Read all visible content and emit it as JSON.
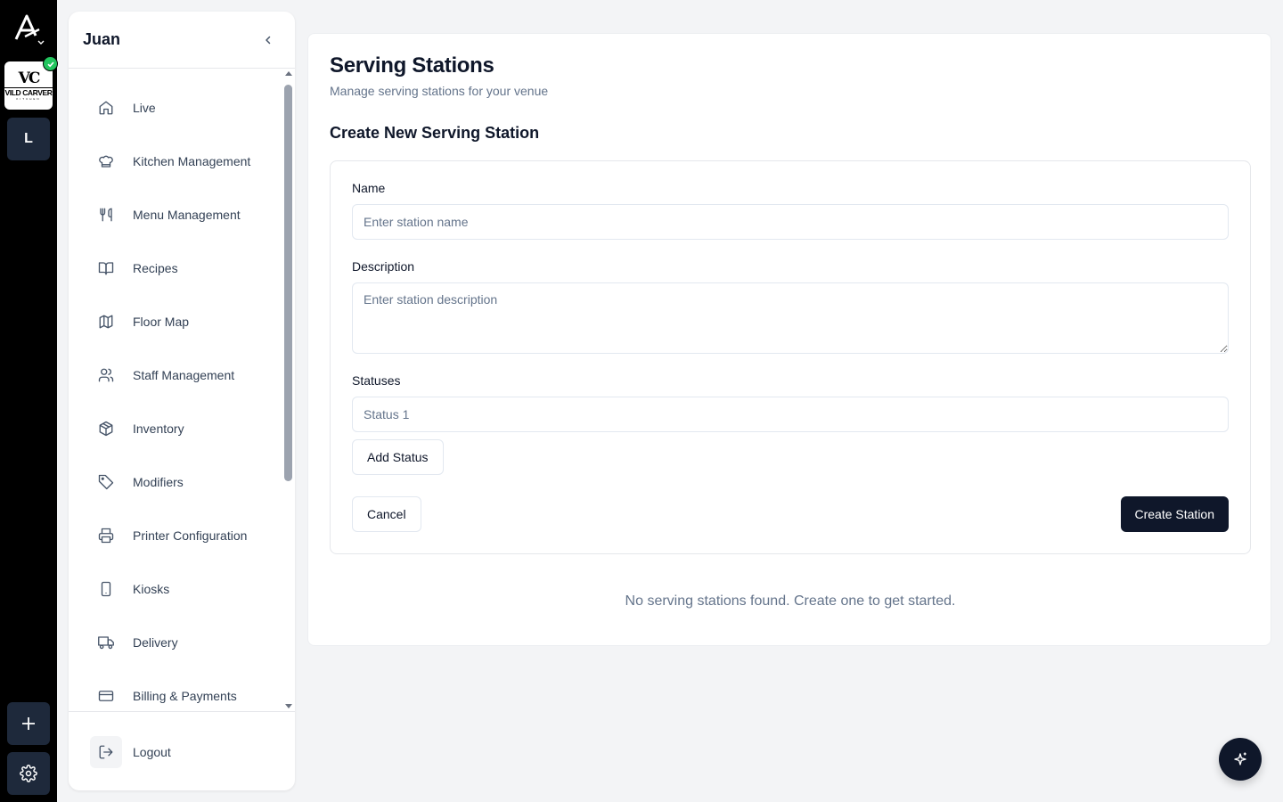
{
  "rail": {
    "venue": {
      "mark": "VC",
      "name": "VILD CARVER",
      "sub": "KITCHEN"
    },
    "workspace_letter": "L"
  },
  "sidebar": {
    "title": "Juan",
    "items": [
      {
        "label": "Live",
        "icon": "home-icon"
      },
      {
        "label": "Kitchen Management",
        "icon": "chef-hat-icon"
      },
      {
        "label": "Menu Management",
        "icon": "utensils-icon"
      },
      {
        "label": "Recipes",
        "icon": "book-open-icon"
      },
      {
        "label": "Floor Map",
        "icon": "map-icon"
      },
      {
        "label": "Staff Management",
        "icon": "users-icon"
      },
      {
        "label": "Inventory",
        "icon": "package-icon"
      },
      {
        "label": "Modifiers",
        "icon": "tag-icon"
      },
      {
        "label": "Printer Configuration",
        "icon": "printer-icon"
      },
      {
        "label": "Kiosks",
        "icon": "tablet-icon"
      },
      {
        "label": "Delivery",
        "icon": "truck-icon"
      },
      {
        "label": "Billing & Payments",
        "icon": "credit-card-icon"
      }
    ],
    "logout_label": "Logout"
  },
  "page": {
    "title": "Serving Stations",
    "subtitle": "Manage serving stations for your venue",
    "section_title": "Create New Serving Station",
    "form": {
      "name_label": "Name",
      "name_placeholder": "Enter station name",
      "name_value": "",
      "description_label": "Description",
      "description_placeholder": "Enter station description",
      "statuses_label": "Statuses",
      "status_placeholder": "Status 1",
      "add_status_label": "Add Status",
      "cancel_label": "Cancel",
      "create_label": "Create Station"
    },
    "empty_message": "No serving stations found. Create one to get started."
  },
  "colors": {
    "rail_bg": "#000000",
    "rail_button": "#1e293b",
    "primary": "#0f172a",
    "muted_text": "#64748b",
    "success": "#22c55e",
    "page_bg": "#f3f4f6"
  }
}
